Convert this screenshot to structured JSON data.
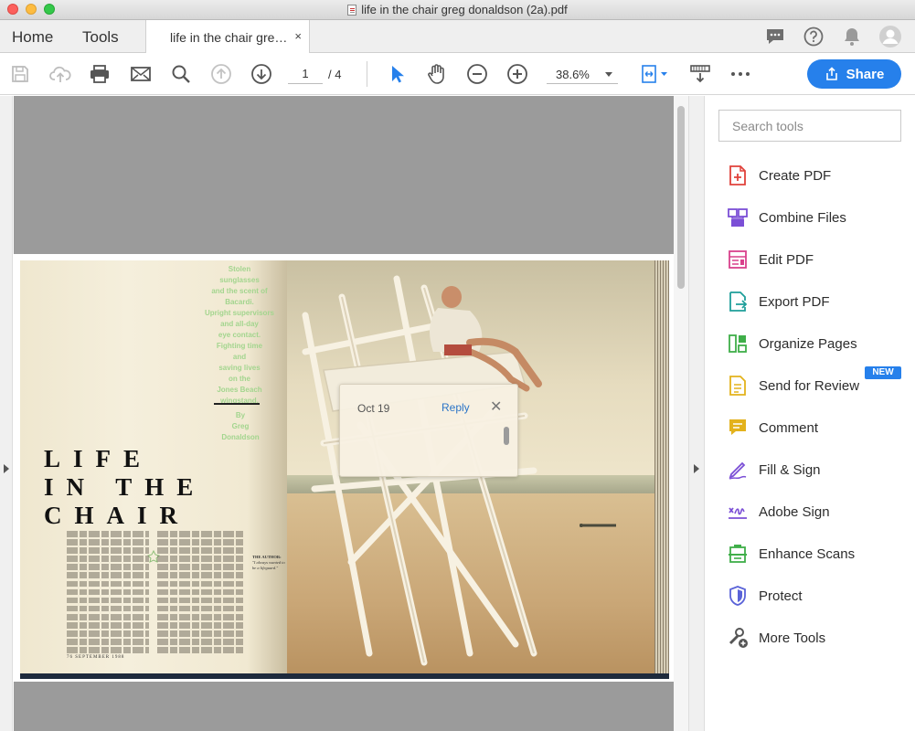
{
  "window": {
    "title": "life in the chair greg donaldson (2a).pdf"
  },
  "tabbar": {
    "home_label": "Home",
    "tools_label": "Tools",
    "doc_tab_label": "life in the chair gre…",
    "doc_tab_close": "×"
  },
  "toolbar": {
    "page_current": "1",
    "page_total": "/ 4",
    "zoom": "38.6%",
    "share_label": "Share"
  },
  "magazine": {
    "pull_quote": [
      "Stolen",
      "sunglasses",
      "and the scent of",
      "Bacardi.",
      "Upright supervisors",
      "and all-day",
      "eye contact.",
      "Fighting time",
      "and",
      "saving lives",
      "on the",
      "Jones Beach",
      "wingstand."
    ],
    "byline": [
      "By",
      "Greg",
      "Donaldson"
    ],
    "title_lines": [
      "LIFE",
      "IN THE",
      "CHAIR"
    ],
    "folio": "76 SEPTEMBER 1988",
    "author_heading": "THE AUTHOR:",
    "author_text": "\"I always wanted to be a lifeguard.\""
  },
  "comment_popup": {
    "date": "Oct 19",
    "reply_label": "Reply",
    "close": "✕"
  },
  "tools_panel": {
    "search_placeholder": "Search tools",
    "badge_new": "NEW",
    "items": [
      {
        "label": "Create PDF",
        "icon": "create-pdf-icon",
        "color": "#e0423b"
      },
      {
        "label": "Combine Files",
        "icon": "combine-files-icon",
        "color": "#7b4fd6"
      },
      {
        "label": "Edit PDF",
        "icon": "edit-pdf-icon",
        "color": "#d9418c"
      },
      {
        "label": "Export PDF",
        "icon": "export-pdf-icon",
        "color": "#1f9f9a"
      },
      {
        "label": "Organize Pages",
        "icon": "organize-pages-icon",
        "color": "#3fae49"
      },
      {
        "label": "Send for Review",
        "icon": "send-review-icon",
        "color": "#e3b21c"
      },
      {
        "label": "Comment",
        "icon": "comment-icon",
        "color": "#e3b21c"
      },
      {
        "label": "Fill & Sign",
        "icon": "fill-sign-icon",
        "color": "#7b4fd6"
      },
      {
        "label": "Adobe Sign",
        "icon": "adobe-sign-icon",
        "color": "#7b4fd6"
      },
      {
        "label": "Enhance Scans",
        "icon": "enhance-scans-icon",
        "color": "#3fae49"
      },
      {
        "label": "Protect",
        "icon": "protect-icon",
        "color": "#5a63d8"
      },
      {
        "label": "More Tools",
        "icon": "more-tools-icon",
        "color": "#555555"
      }
    ]
  },
  "colors": {
    "accent": "#2680eb"
  }
}
